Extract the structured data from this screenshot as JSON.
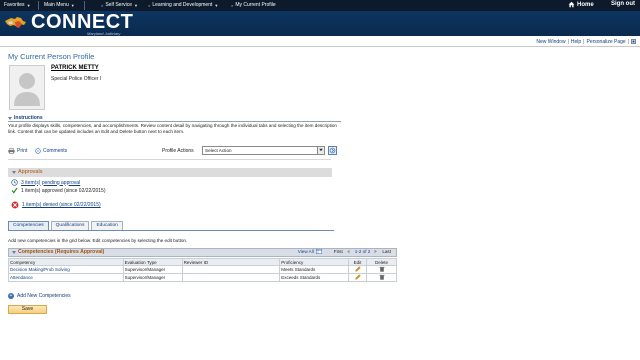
{
  "topnav": {
    "items": [
      "Favorites",
      "Main Menu",
      "Self Service",
      "Learning and Development",
      "My Current Profile"
    ],
    "home": "Home",
    "signout": "Sign out"
  },
  "brand": {
    "title": "CONNECT",
    "subtitle": "Maryland Judiciary"
  },
  "utility_links": {
    "new_window": "New Window",
    "help": "Help",
    "personalize": "Personalize Page"
  },
  "page": {
    "title": "My Current Person Profile"
  },
  "person": {
    "name": "PATRICK METTY",
    "job_title": "Special Police Officer I"
  },
  "instructions": {
    "heading": "Instructions",
    "text": "Your profile displays skills, competencies, and accomplishments. Review content detail by navigating through the individual tabs and selecting the item description link. Content that can be updated includes an Edit and Delete button next to each item."
  },
  "actions": {
    "print": "Print",
    "comments": "Comments",
    "profile_actions_label": "Profile Actions",
    "profile_actions_value": "Select Action"
  },
  "approvals": {
    "heading": "Approvals",
    "pending": "3 item(s) pending approval",
    "approved": "1 item(s) approved (since 02/22/2015)",
    "denied": "1 item(s) denied (since 02/22/2015)"
  },
  "tabs": [
    "Competencies",
    "Qualifications",
    "Education"
  ],
  "grid": {
    "hint": "Add new competencies in the grid below. Edit competencies by selecting the edit button.",
    "title": "Competencies (Requires Approval)",
    "view_all": "View All",
    "first": "First",
    "range": "1-2 of 2",
    "last": "Last",
    "columns": [
      "Competency",
      "Evaluation Type",
      "Reviewer ID",
      "Proficiency",
      "Edit",
      "Delete"
    ],
    "rows": [
      {
        "competency": "Decision Making/Prob Solving",
        "evaluation_type": "Supervisor/Manager",
        "reviewer_id": "",
        "proficiency": "Meets Standards"
      },
      {
        "competency": "Attendance",
        "evaluation_type": "Supervisor/Manager",
        "reviewer_id": "",
        "proficiency": "Exceeds Standards"
      }
    ]
  },
  "add_new": "Add New Competencies",
  "save": "Save",
  "colors": {
    "topbar": "#0d1a2b",
    "banner": "#0a2a4e",
    "link": "#123f80",
    "section_heading": "#a2540d",
    "save_button": "#f6cf7d"
  }
}
